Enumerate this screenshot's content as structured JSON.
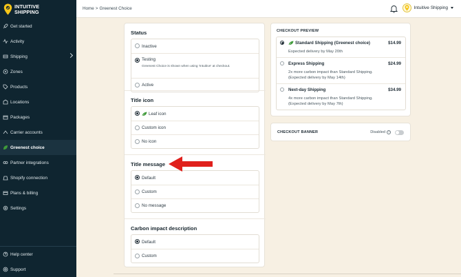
{
  "brand": {
    "line1": "INTUITIVE",
    "line2": "SHIPPING"
  },
  "sidebar": {
    "items": [
      {
        "label": "Get started",
        "icon": "rocket-icon"
      },
      {
        "label": "Activity",
        "icon": "activity-icon"
      },
      {
        "label": "Shipping",
        "icon": "shipping-icon"
      },
      {
        "label": "Zones",
        "icon": "zones-icon"
      },
      {
        "label": "Products",
        "icon": "products-icon"
      },
      {
        "label": "Locations",
        "icon": "locations-icon"
      },
      {
        "label": "Packages",
        "icon": "packages-icon"
      },
      {
        "label": "Carrier accounts",
        "icon": "carrier-icon"
      },
      {
        "label": "Greenest choice",
        "icon": "leaf-icon"
      },
      {
        "label": "Partner integrations",
        "icon": "partner-icon"
      },
      {
        "label": "Shopify connection",
        "icon": "shopify-icon"
      },
      {
        "label": "Plans & billing",
        "icon": "billing-icon"
      },
      {
        "label": "Settings",
        "icon": "settings-icon"
      }
    ],
    "bottom": [
      {
        "label": "Help center",
        "icon": "help-icon"
      },
      {
        "label": "Support",
        "icon": "support-icon"
      }
    ]
  },
  "topbar": {
    "breadcrumb_home": "Home",
    "breadcrumb_sep": ">",
    "breadcrumb_current": "Greenest Choice",
    "user_name": "Intuitive Shipping"
  },
  "status": {
    "title": "Status",
    "options": [
      "Inactive",
      "Testing",
      "Active"
    ],
    "testing_note": "Greenest Choice is shown when using 'Intuitive' at checkout."
  },
  "title_icon": {
    "title": "Title icon",
    "options": [
      "Leaf icon",
      "Custom icon",
      "No icon"
    ]
  },
  "title_message": {
    "title": "Title message",
    "options": [
      "Default",
      "Custom",
      "No message"
    ]
  },
  "carbon": {
    "title": "Carbon impact description",
    "options": [
      "Default",
      "Custom"
    ]
  },
  "preview": {
    "title": "CHECKOUT PREVIEW",
    "rates": [
      {
        "name": "Standard Shipping (Greenest choice)",
        "price": "$14.99",
        "desc1": "Expected delivery by May 20th",
        "desc2": ""
      },
      {
        "name": "Express Shipping",
        "price": "$24.99",
        "desc1": "2x more carbon impact than Standard Shipping.",
        "desc2": "(Expected delivery by May 14th)"
      },
      {
        "name": "Next-day Shipping",
        "price": "$34.99",
        "desc1": "4x more carbon impact than Standard Shipping.",
        "desc2": "(Expected delivery by May 7th)"
      }
    ]
  },
  "banner": {
    "title": "CHECKOUT BANNER",
    "status": "Disabled"
  },
  "colors": {
    "sidebar": "#0f2530",
    "background": "#f7f0e3",
    "accent_leaf": "#3f9a3a",
    "arrow": "#e0201c",
    "logo_yellow": "#f5c518"
  }
}
